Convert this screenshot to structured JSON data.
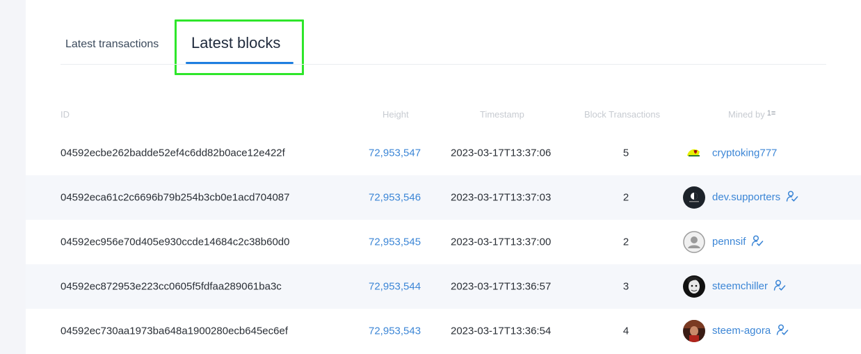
{
  "tabs": {
    "latest_transactions": "Latest transactions",
    "latest_blocks": "Latest blocks"
  },
  "table": {
    "headers": {
      "id": "ID",
      "height": "Height",
      "timestamp": "Timestamp",
      "block_transactions": "Block Transactions",
      "mined_by": "Mined by"
    },
    "rows": [
      {
        "id": "04592ecbe262badde52ef4c6dd82b0ace12e422f",
        "height": "72,953,547",
        "timestamp": "2023-03-17T13:37:06",
        "tx": "5",
        "miner": "cryptoking777",
        "avatar": "bird-avatar",
        "verified": false
      },
      {
        "id": "04592eca61c2c6696b79b254b3cb0e1acd704087",
        "height": "72,953,546",
        "timestamp": "2023-03-17T13:37:03",
        "tx": "2",
        "miner": "dev.supporters",
        "avatar": "dark-logo-avatar",
        "verified": true
      },
      {
        "id": "04592ec956e70d405e930ccde14684c2c38b60d0",
        "height": "72,953,545",
        "timestamp": "2023-03-17T13:37:00",
        "tx": "2",
        "miner": "pennsif",
        "avatar": "default-user-avatar",
        "verified": true
      },
      {
        "id": "04592ec872953e223cc0605f5fdfaa289061ba3c",
        "height": "72,953,544",
        "timestamp": "2023-03-17T13:36:57",
        "tx": "3",
        "miner": "steemchiller",
        "avatar": "bw-portrait-avatar",
        "verified": true
      },
      {
        "id": "04592ec730aa1973ba648a1900280ecb645ec6ef",
        "height": "72,953,543",
        "timestamp": "2023-03-17T13:36:54",
        "tx": "4",
        "miner": "steem-agora",
        "avatar": "red-photo-avatar",
        "verified": true
      }
    ]
  },
  "colors": {
    "link": "#3c86d6",
    "active_tab_underline": "#1e7ee0",
    "highlight_box": "#2ee62a"
  }
}
